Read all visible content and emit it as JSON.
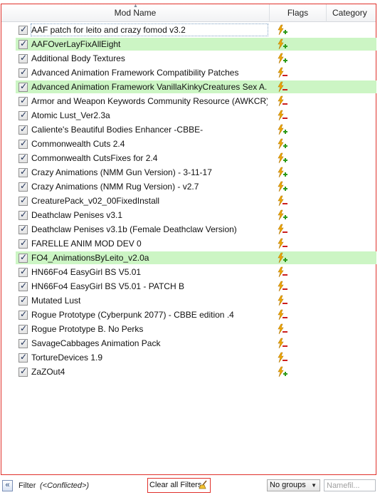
{
  "columns": {
    "name": "Mod Name",
    "flags": "Flags",
    "category": "Category"
  },
  "mods": [
    {
      "name": "AAF patch for leito and crazy fomod v3.2",
      "checked": true,
      "highlight": false,
      "selected": true,
      "flag": "plus"
    },
    {
      "name": "AAFOverLayFixAllEight",
      "checked": true,
      "highlight": true,
      "selected": false,
      "flag": "plus"
    },
    {
      "name": "Additional Body Textures",
      "checked": true,
      "highlight": false,
      "selected": false,
      "flag": "plus"
    },
    {
      "name": "Advanced Animation Framework Compatibility Patches",
      "checked": true,
      "highlight": false,
      "selected": false,
      "flag": "minus"
    },
    {
      "name": "Advanced Animation Framework VanillaKinkyCreatures Sex A...",
      "checked": true,
      "highlight": true,
      "selected": false,
      "flag": "minus"
    },
    {
      "name": "Armor and Weapon Keywords Community Resource (AWKCR)",
      "checked": true,
      "highlight": false,
      "selected": false,
      "flag": "minus"
    },
    {
      "name": "Atomic Lust_Ver2.3a",
      "checked": true,
      "highlight": false,
      "selected": false,
      "flag": "minus"
    },
    {
      "name": "Caliente's Beautiful Bodies Enhancer -CBBE-",
      "checked": true,
      "highlight": false,
      "selected": false,
      "flag": "plus"
    },
    {
      "name": "Commonwealth Cuts 2.4",
      "checked": true,
      "highlight": false,
      "selected": false,
      "flag": "plus"
    },
    {
      "name": "Commonwealth CutsFixes for 2.4",
      "checked": true,
      "highlight": false,
      "selected": false,
      "flag": "plus"
    },
    {
      "name": "Crazy Animations (NMM Gun Version) - 3-11-17",
      "checked": true,
      "highlight": false,
      "selected": false,
      "flag": "plus"
    },
    {
      "name": "Crazy Animations (NMM Rug Version) - v2.7",
      "checked": true,
      "highlight": false,
      "selected": false,
      "flag": "plus"
    },
    {
      "name": "CreaturePack_v02_00FixedInstall",
      "checked": true,
      "highlight": false,
      "selected": false,
      "flag": "minus"
    },
    {
      "name": "Deathclaw Penises v3.1",
      "checked": true,
      "highlight": false,
      "selected": false,
      "flag": "plus"
    },
    {
      "name": "Deathclaw Penises v3.1b (Female Deathclaw Version)",
      "checked": true,
      "highlight": false,
      "selected": false,
      "flag": "minus"
    },
    {
      "name": "FARELLE ANIM MOD DEV 0",
      "checked": true,
      "highlight": false,
      "selected": false,
      "flag": "minus"
    },
    {
      "name": "FO4_AnimationsByLeito_v2.0a",
      "checked": true,
      "highlight": true,
      "selected": false,
      "flag": "plus"
    },
    {
      "name": "HN66Fo4 EasyGirl BS V5.01",
      "checked": true,
      "highlight": false,
      "selected": false,
      "flag": "minus"
    },
    {
      "name": "HN66Fo4 EasyGirl BS V5.01 - PATCH B",
      "checked": true,
      "highlight": false,
      "selected": false,
      "flag": "minus"
    },
    {
      "name": "Mutated Lust",
      "checked": true,
      "highlight": false,
      "selected": false,
      "flag": "minus"
    },
    {
      "name": "Rogue Prototype (Cyberpunk 2077) - CBBE edition .4",
      "checked": true,
      "highlight": false,
      "selected": false,
      "flag": "minus"
    },
    {
      "name": "Rogue Prototype B. No Perks",
      "checked": true,
      "highlight": false,
      "selected": false,
      "flag": "minus"
    },
    {
      "name": "SavageCabbages Animation Pack",
      "checked": true,
      "highlight": false,
      "selected": false,
      "flag": "minus"
    },
    {
      "name": "TortureDevices 1.9",
      "checked": true,
      "highlight": false,
      "selected": false,
      "flag": "minus"
    },
    {
      "name": "ZaZOut4",
      "checked": true,
      "highlight": false,
      "selected": false,
      "flag": "plus"
    }
  ],
  "footer": {
    "collapse_glyph": "«",
    "filter_label": "Filter",
    "filter_value": "(<Conflicted>)",
    "clear_label": "Clear all Filters",
    "groups_value": "No groups",
    "namefilter_placeholder": "Namefil..."
  },
  "colors": {
    "highlight": "#ccf5c4",
    "frame_border": "#e0302a",
    "flag_plus": "#2e9a1a",
    "flag_minus": "#cc1f1f",
    "bolt": "#f0a800"
  }
}
